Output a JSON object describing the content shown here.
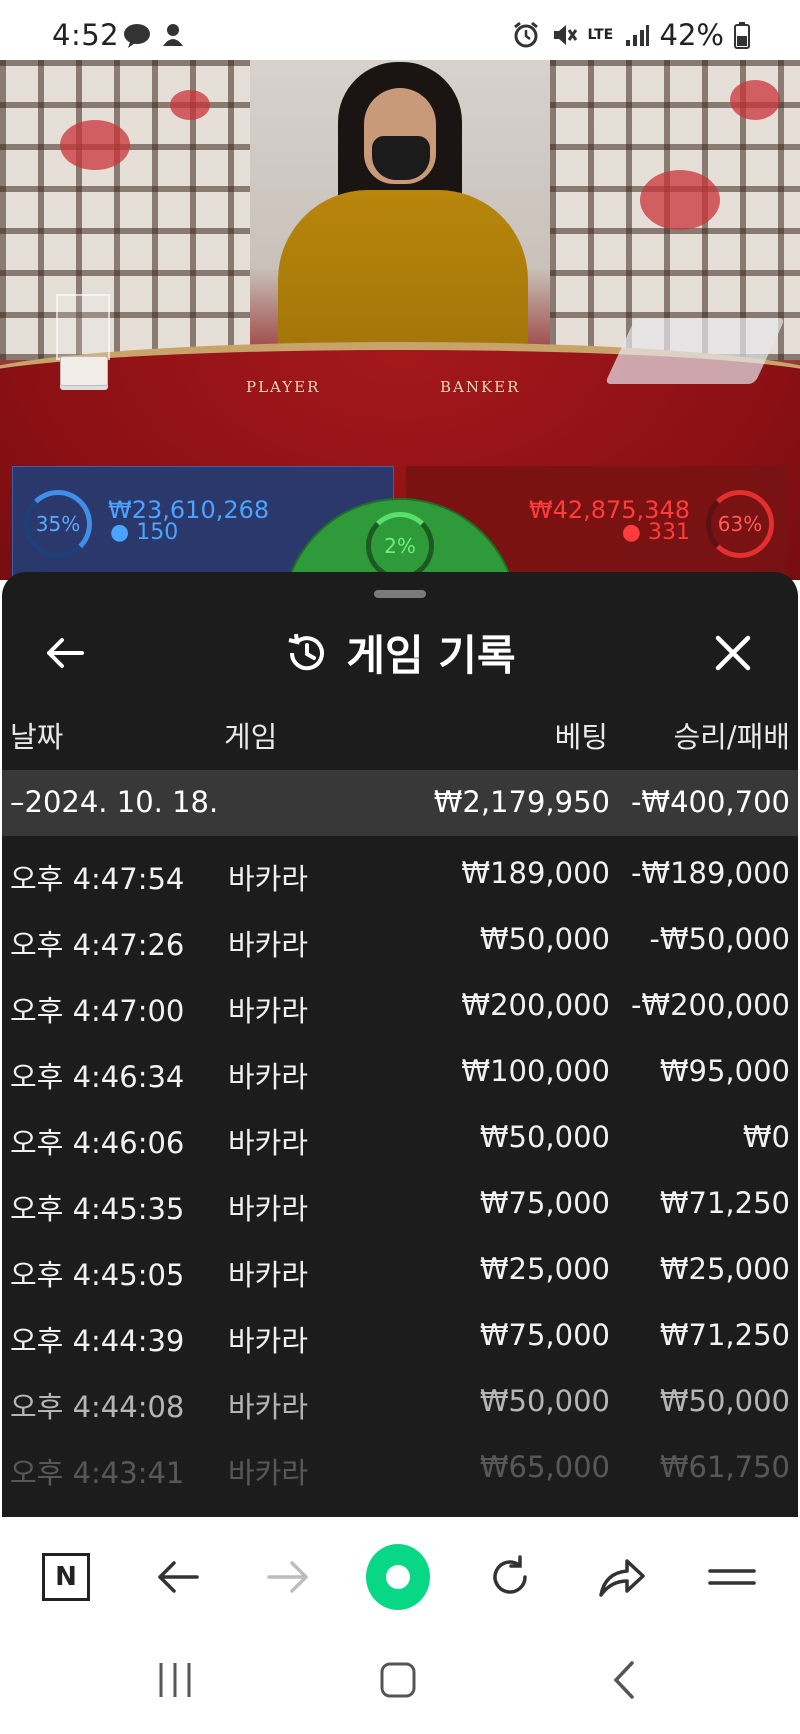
{
  "status_bar": {
    "time": "4:52",
    "network": "LTE",
    "battery": "42%",
    "icons": [
      "messenger-icon",
      "notification-app-icon",
      "alarm-icon",
      "mute-icon",
      "lte-icon",
      "signal-icon",
      "battery-icon"
    ]
  },
  "game_view": {
    "table_labels": {
      "player": "PLAYER",
      "banker": "BANKER"
    },
    "player": {
      "percent": "35%",
      "amount": "₩23,610,268",
      "count": "150"
    },
    "tie": {
      "percent": "2%"
    },
    "banker": {
      "percent": "63%",
      "amount": "₩42,875,348",
      "count": "331"
    }
  },
  "history": {
    "title": "게임 기록",
    "columns": {
      "date": "날짜",
      "game": "게임",
      "bet": "베팅",
      "result": "승리/패배"
    },
    "summary": {
      "date": "–2024. 10. 18.",
      "bet": "₩2,179,950",
      "result": "-₩400,700"
    },
    "rows": [
      {
        "time": "오후 4:47:54",
        "game": "바카라",
        "bet": "₩189,000",
        "result": "-₩189,000"
      },
      {
        "time": "오후 4:47:26",
        "game": "바카라",
        "bet": "₩50,000",
        "result": "-₩50,000"
      },
      {
        "time": "오후 4:47:00",
        "game": "바카라",
        "bet": "₩200,000",
        "result": "-₩200,000"
      },
      {
        "time": "오후 4:46:34",
        "game": "바카라",
        "bet": "₩100,000",
        "result": "₩95,000"
      },
      {
        "time": "오후 4:46:06",
        "game": "바카라",
        "bet": "₩50,000",
        "result": "₩0"
      },
      {
        "time": "오후 4:45:35",
        "game": "바카라",
        "bet": "₩75,000",
        "result": "₩71,250"
      },
      {
        "time": "오후 4:45:05",
        "game": "바카라",
        "bet": "₩25,000",
        "result": "₩25,000"
      },
      {
        "time": "오후 4:44:39",
        "game": "바카라",
        "bet": "₩75,000",
        "result": "₩71,250"
      },
      {
        "time": "오후 4:44:08",
        "game": "바카라",
        "bet": "₩50,000",
        "result": "₩50,000"
      },
      {
        "time": "오후 4:43:41",
        "game": "바카라",
        "bet": "₩65,000",
        "result": "₩61,750"
      }
    ]
  },
  "browser_toolbar": {
    "home_label": "N",
    "icons": [
      "naver-home-icon",
      "back-arrow-icon",
      "forward-arrow-icon",
      "green-dot-icon",
      "reload-icon",
      "share-icon",
      "menu-icon"
    ]
  },
  "colors": {
    "player": "#4aa3ff",
    "banker": "#ff3c3c",
    "tie": "#2f9a3a",
    "sheet_bg": "#1c1c1c",
    "summary_bg": "#383838",
    "accent_green": "#08d885"
  }
}
